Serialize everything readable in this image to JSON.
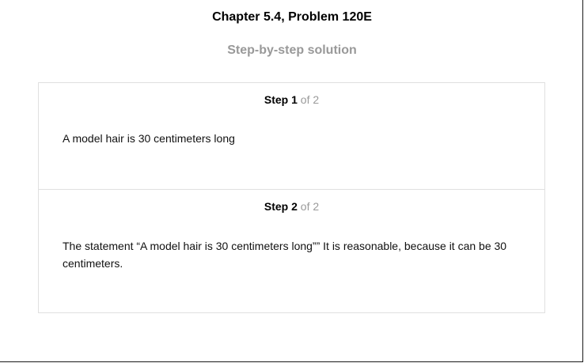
{
  "header": {
    "title": "Chapter 5.4, Problem 120E",
    "subtitle": "Step-by-step solution"
  },
  "steps": [
    {
      "word": "Step",
      "number": "1",
      "of_label": "of 2",
      "text": "A model hair is 30 centimeters long"
    },
    {
      "word": "Step",
      "number": "2",
      "of_label": "of 2",
      "text": "The statement “A model hair is 30 centimeters long”” It is reasonable, because it can be 30 centimeters."
    }
  ]
}
